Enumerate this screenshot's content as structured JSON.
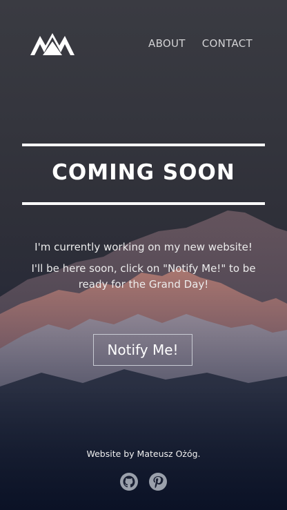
{
  "header": {
    "logo_icon": "mountain-logo-icon",
    "nav": [
      {
        "label": "ABOUT"
      },
      {
        "label": "CONTACT"
      }
    ]
  },
  "hero": {
    "title": "COMING SOON",
    "message_line1": "I'm currently working on my new website!",
    "message_line2": "I'll be here soon, click on \"Notify Me!\" to be ready for the Grand Day!",
    "button_label": "Notify Me!"
  },
  "footer": {
    "credit": "Website by Mateusz Ożóg.",
    "social_icons": [
      "github-icon",
      "pinterest-icon"
    ]
  },
  "colors": {
    "text": "#ffffff",
    "nav_text": "#d2d2d4",
    "background_top": "#3a3b42",
    "background_bottom": "#0b1226"
  }
}
